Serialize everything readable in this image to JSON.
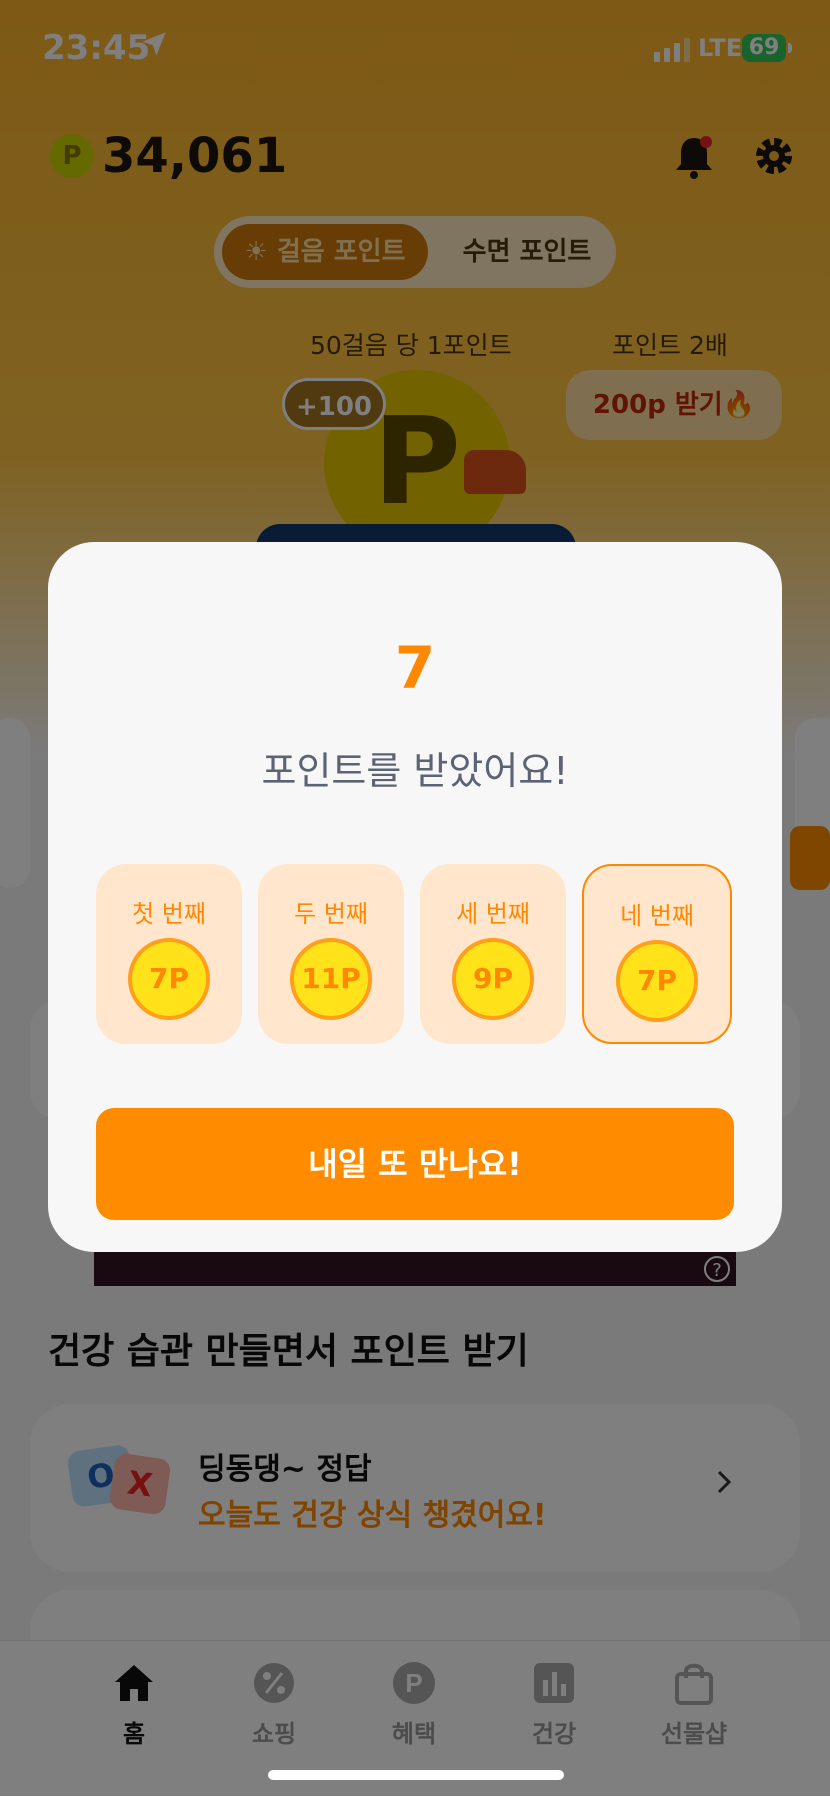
{
  "status_bar": {
    "time": "23:45",
    "network": "LTE",
    "battery": "69"
  },
  "header": {
    "points": "34,061",
    "coin_symbol": "P"
  },
  "mode_toggle": {
    "active": "걸음 포인트",
    "inactive": "수면 포인트"
  },
  "walk": {
    "rate_label": "50걸음 당 1포인트",
    "double_label": "포인트 2배",
    "double_button": "200p 받기🔥",
    "plus_badge": "+100",
    "coin_symbol": "P"
  },
  "modal": {
    "points": "7",
    "message": "포인트를 받았어요!",
    "rounds": [
      {
        "label": "첫 번째",
        "value": "7P"
      },
      {
        "label": "두 번째",
        "value": "11P"
      },
      {
        "label": "세 번째",
        "value": "9P"
      },
      {
        "label": "네 번째",
        "value": "7P"
      }
    ],
    "current_round": 4,
    "cta": "내일 또 만나요!"
  },
  "banner": {
    "help": "?"
  },
  "section": {
    "title": "건강 습관 만들면서 포인트 받기",
    "quiz_title": "딩동댕~ 정답",
    "quiz_subtitle": "오늘도 건강 상식 챙겼어요!",
    "ox_o": "O",
    "ox_x": "X"
  },
  "tabbar": {
    "items": [
      {
        "label": "홈",
        "icon": "home-icon",
        "active": true
      },
      {
        "label": "쇼핑",
        "icon": "percent-badge-icon",
        "active": false
      },
      {
        "label": "혜택",
        "icon": "p-coin-icon",
        "active": false
      },
      {
        "label": "건강",
        "icon": "bar-chart-icon",
        "active": false
      },
      {
        "label": "선물샵",
        "icon": "shopping-bag-icon",
        "active": false
      }
    ]
  },
  "colors": {
    "accent": "#ff8c00",
    "modal_bg": "#f7f7f7",
    "round_bg": "#ffe6cc"
  }
}
